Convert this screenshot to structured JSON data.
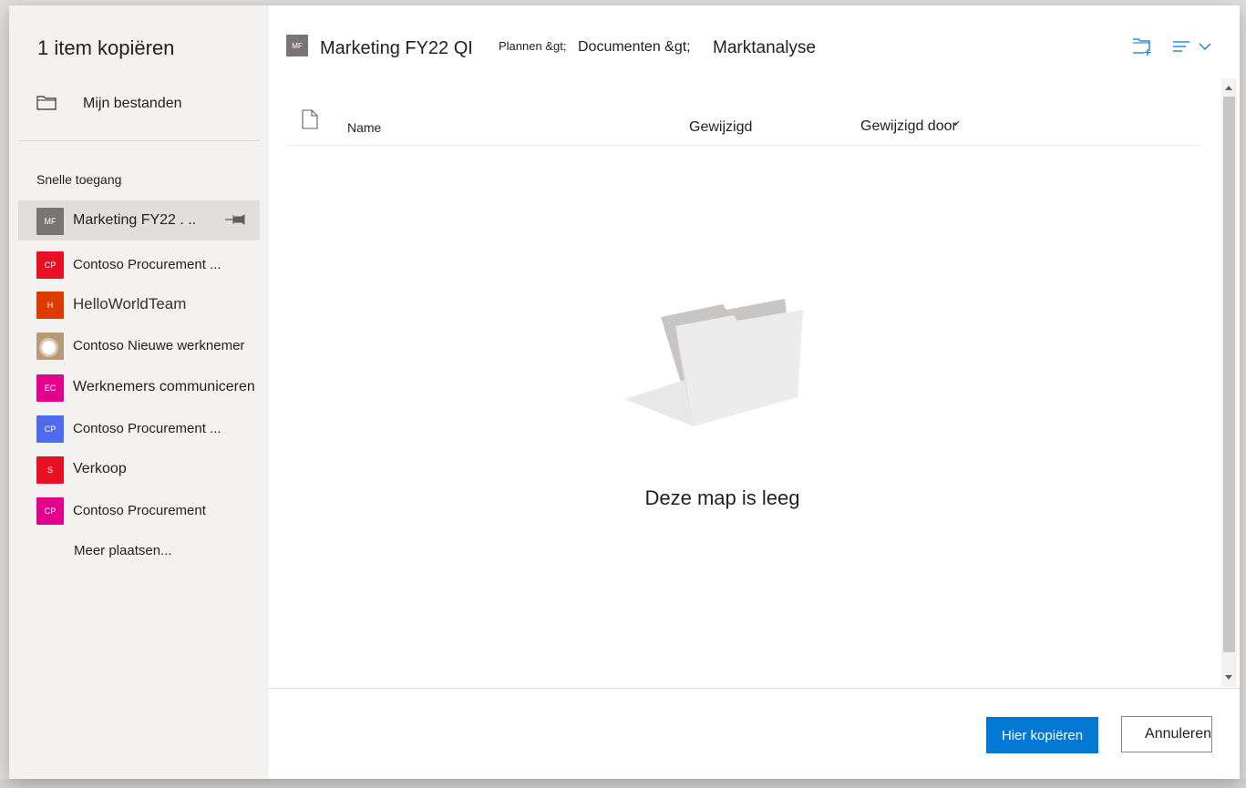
{
  "dialog": {
    "title": "1 item kopiëren"
  },
  "leftnav": {
    "my_files": "Mijn bestanden",
    "quick_access_label": "Snelle toegang",
    "sites": [
      {
        "badge": "MF",
        "label": "Marketing FY22 .   ..",
        "color": "#7a7574",
        "selected": true,
        "pinned": true
      },
      {
        "badge": "CP",
        "label": "Contoso Procurement ...",
        "color": "#e81123"
      },
      {
        "badge": "H",
        "label": "HelloWorldTeam",
        "color": "#da3b01"
      },
      {
        "badge": "",
        "label": "Contoso Nieuwe werknemer",
        "color": "#b89a76",
        "image": "coffee-cup-image"
      },
      {
        "badge": "EC",
        "label": "Werknemers communiceren",
        "color": "#e3008c"
      },
      {
        "badge": "CP",
        "label": "Contoso Procurement ...",
        "color": "#4f6bed"
      },
      {
        "badge": "S",
        "label": "Verkoop",
        "color": "#e81123"
      },
      {
        "badge": "CP",
        "label": "Contoso Procurement",
        "color": "#e3008c"
      }
    ],
    "more_places": "Meer plaatsen..."
  },
  "breadcrumb": {
    "site_badge": "MF",
    "site": "Marketing FY22 QI",
    "level1": "Plannen &gt;",
    "level2": "Documenten &gt;",
    "current": "Marktanalyse"
  },
  "list": {
    "col_name": "Name",
    "col_modified": "Gewijzigd",
    "col_modified_by": "Gewijzigd door",
    "empty_message": "Deze map is leeg"
  },
  "footer": {
    "primary": "Hier kopiëren",
    "secondary": "Annuleren"
  },
  "colors": {
    "accent": "#0078d4",
    "nav_bg": "#f3f2f1",
    "selected_bg": "#e1dfdd"
  }
}
